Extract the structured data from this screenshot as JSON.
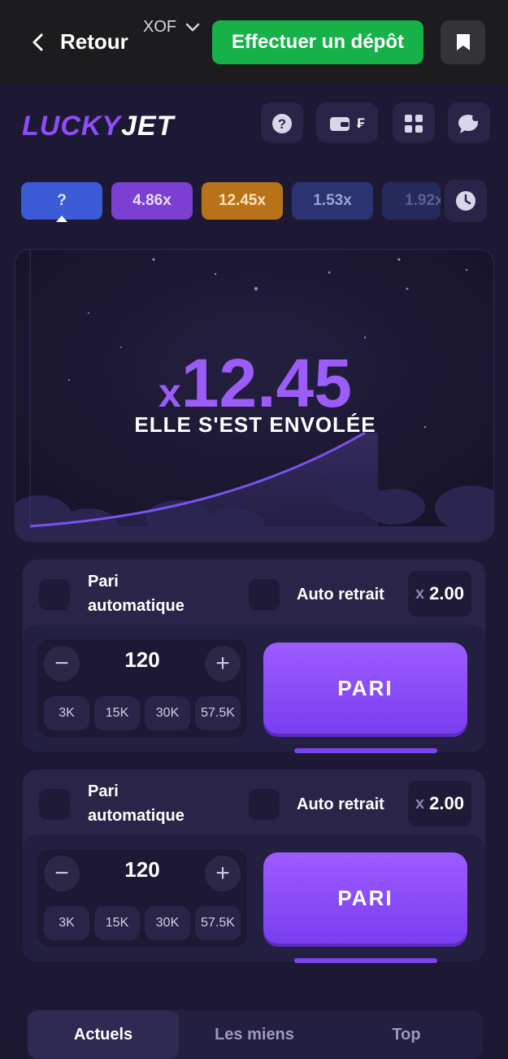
{
  "topbar": {
    "back_label": "Retour",
    "currency": "XOF",
    "deposit_label": "Effectuer un dépôt"
  },
  "logo": {
    "part1": "LUCKY",
    "part2": "JET"
  },
  "header": {
    "wallet_label": "₣"
  },
  "history": [
    {
      "label": "?",
      "color": "#3b5bd6"
    },
    {
      "label": "4.86x",
      "color": "#7b3fd2"
    },
    {
      "label": "12.45x",
      "color": "#b8731a"
    },
    {
      "label": "1.53x",
      "color": "#2b3370"
    },
    {
      "label": "1.92x",
      "color": "#262a5a"
    }
  ],
  "stage": {
    "multiplier_prefix": "x",
    "multiplier_value": "12.45",
    "status_text": "ELLE S'EST ENVOLÉE"
  },
  "bets": [
    {
      "auto_bet_label": "Pari automatique",
      "auto_cashout_label": "Auto retrait",
      "cashout_prefix": "x",
      "cashout_value": "2.00",
      "amount": "120",
      "minus": "−",
      "plus": "+",
      "chips": [
        "3K",
        "15K",
        "30K",
        "57.5K"
      ],
      "button_label": "PARI"
    },
    {
      "auto_bet_label": "Pari automatique",
      "auto_cashout_label": "Auto retrait",
      "cashout_prefix": "x",
      "cashout_value": "2.00",
      "amount": "120",
      "minus": "−",
      "plus": "+",
      "chips": [
        "3K",
        "15K",
        "30K",
        "57.5K"
      ],
      "button_label": "PARI"
    }
  ],
  "tabs": [
    "Actuels",
    "Les miens",
    "Top"
  ],
  "colors": {
    "accent": "#8e4df6",
    "deposit_green": "#17b14a",
    "background": "#1d1934"
  }
}
